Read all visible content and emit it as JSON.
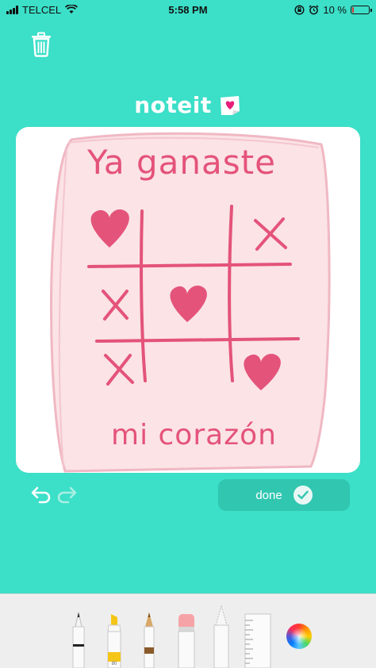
{
  "status_bar": {
    "carrier": "TELCEL",
    "time": "5:58 PM",
    "battery_percent": "10 %",
    "battery_level": 0.1
  },
  "app": {
    "logo_text": "noteit"
  },
  "note": {
    "line1": "Ya ganaste",
    "line2": "mi corazón",
    "ink_color": "#e4537a",
    "paper_color": "#fbe3e6",
    "grid": [
      [
        "heart",
        "",
        "x"
      ],
      [
        "x",
        "heart",
        ""
      ],
      [
        "x",
        "",
        "heart"
      ]
    ]
  },
  "actions": {
    "undo": "undo-icon",
    "redo": "redo-icon",
    "done_label": "done"
  },
  "tools": [
    "pen",
    "marker",
    "pencil",
    "eraser",
    "lasso",
    "ruler",
    "color-picker"
  ],
  "colors": {
    "background": "#3cdfc8",
    "done_button": "#31c6b0",
    "tray": "#eeeeee"
  }
}
